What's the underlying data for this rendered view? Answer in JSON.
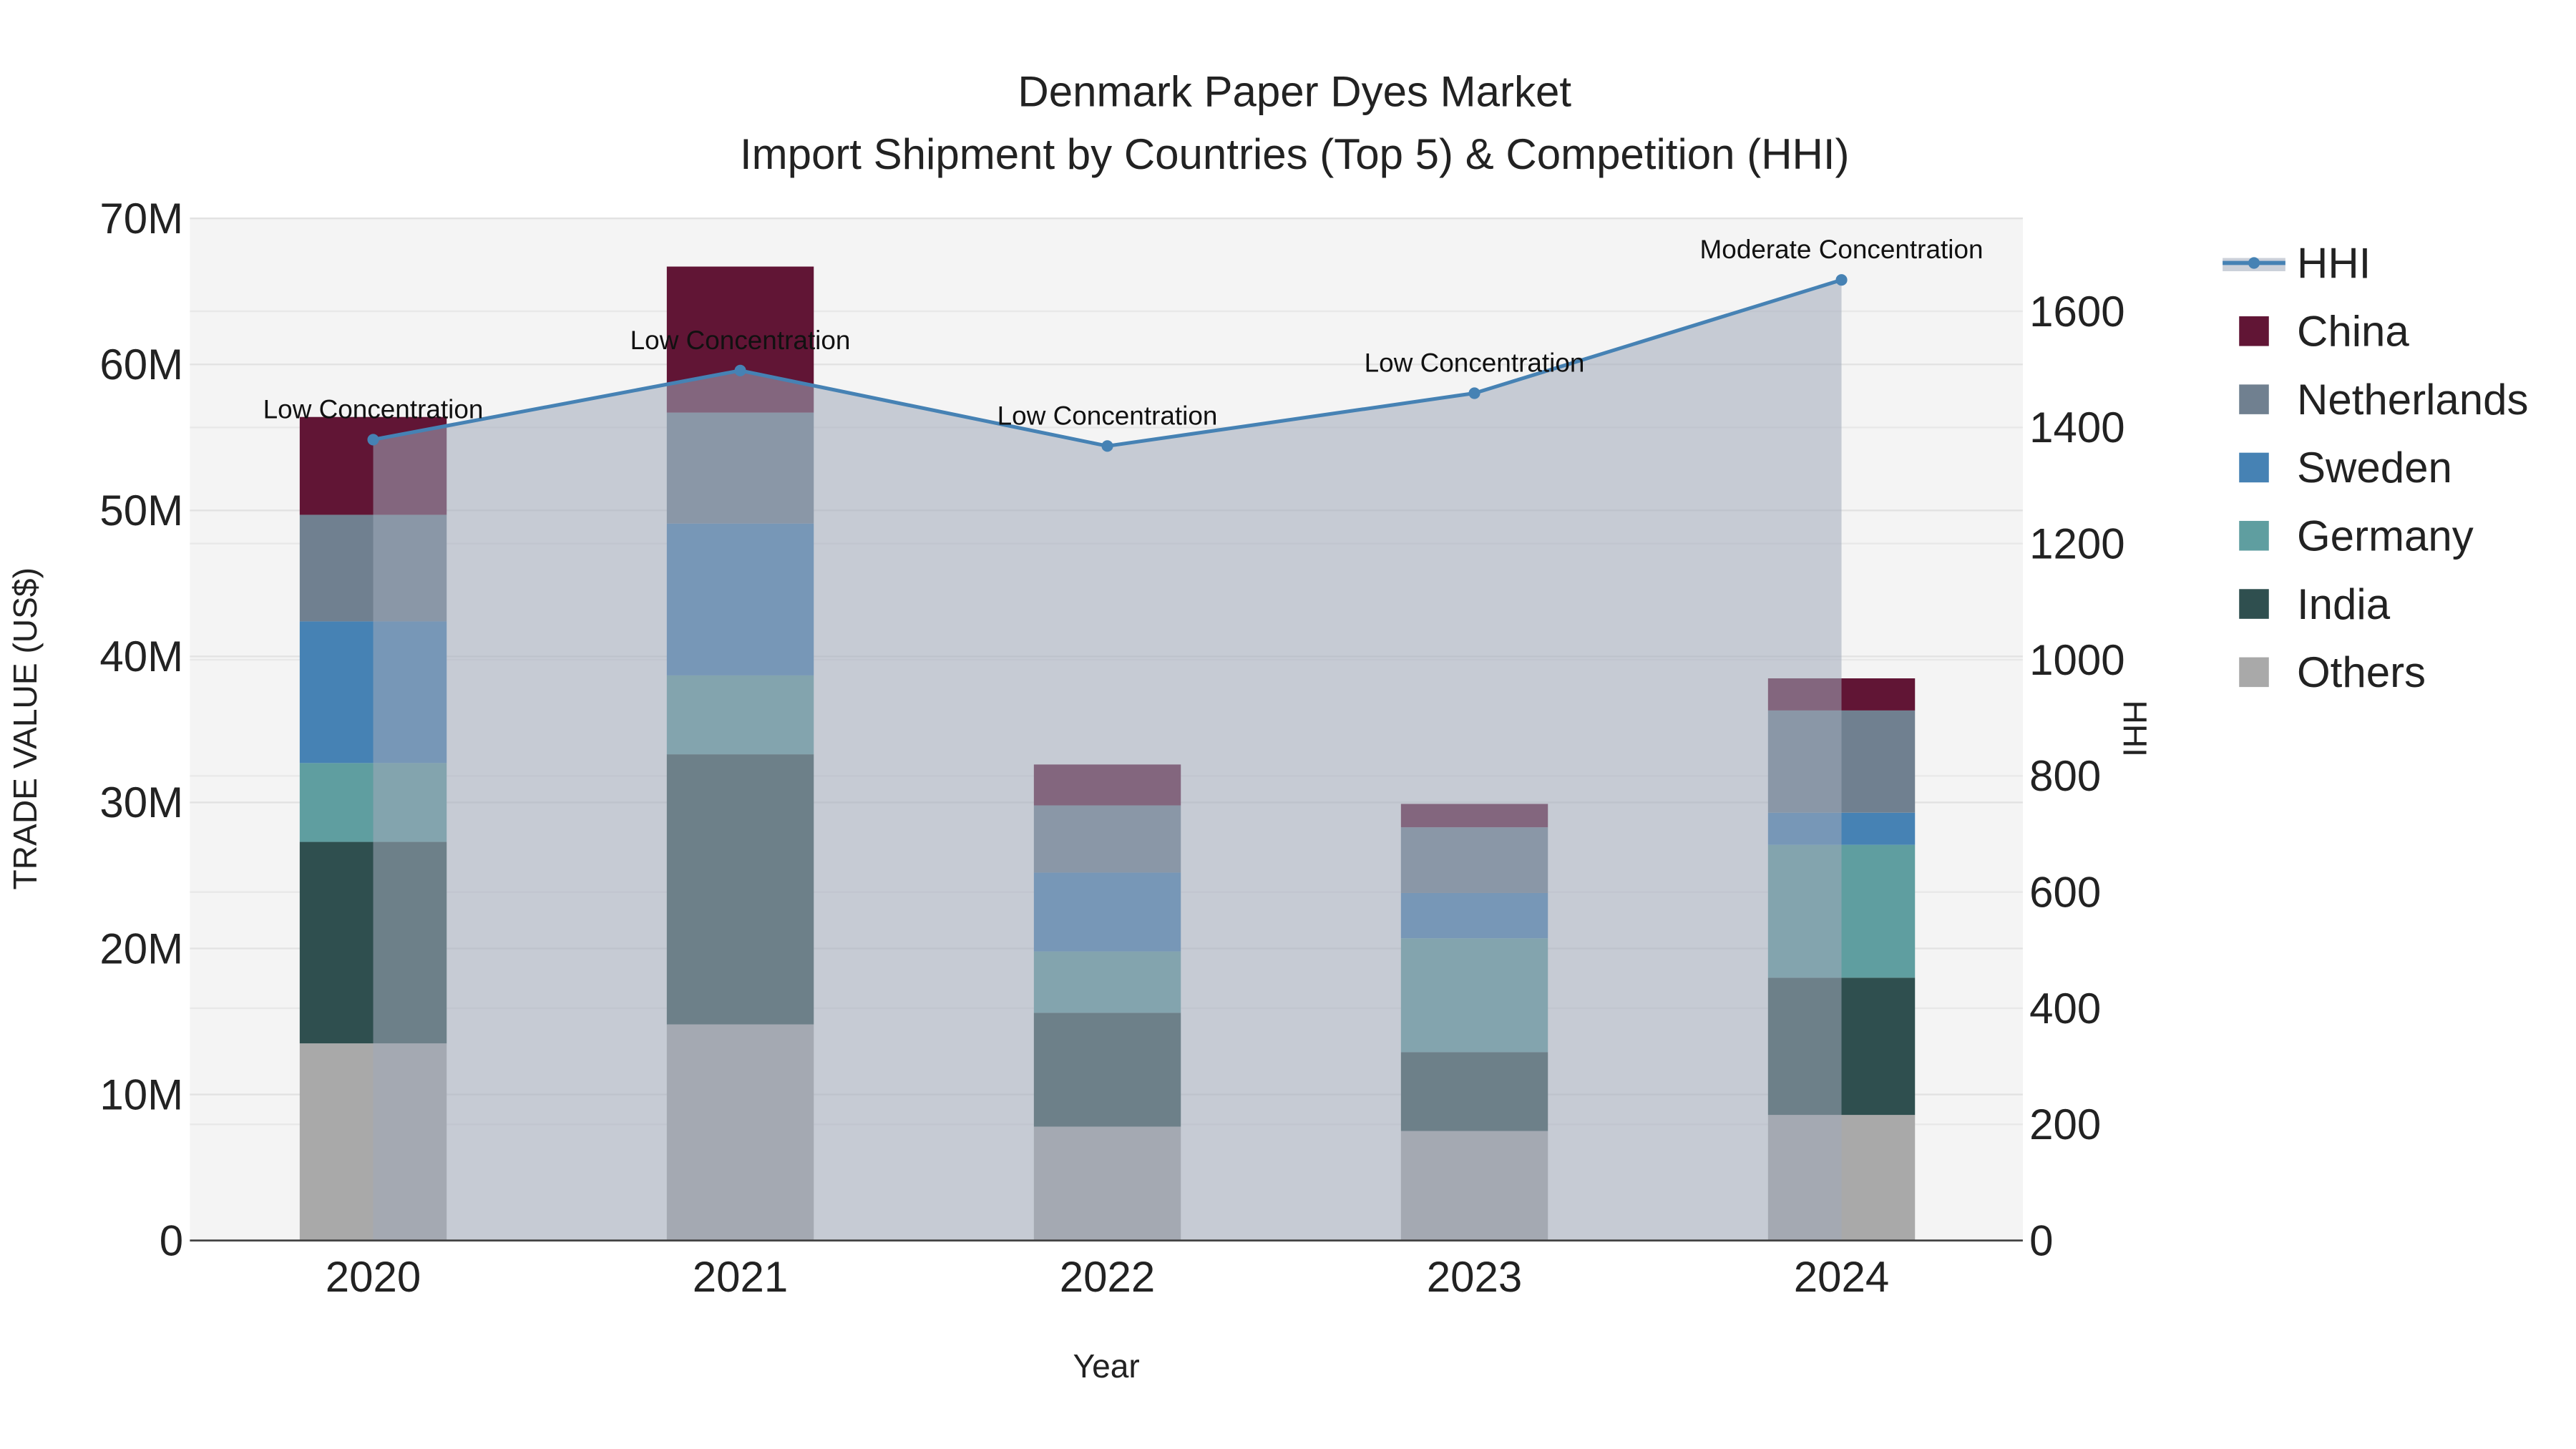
{
  "chart_data": {
    "type": "bar",
    "stacked": true,
    "title": "Denmark Paper Dyes Market",
    "subtitle": "Import Shipment by Countries (Top 5) & Competition (HHI)",
    "xlabel": "Year",
    "ylabel": "TRADE VALUE (US$)",
    "y2label": "HHI",
    "categories": [
      "2020",
      "2021",
      "2022",
      "2023",
      "2024"
    ],
    "ylim": [
      0,
      70000000
    ],
    "y_ticks": [
      0,
      10000000,
      20000000,
      30000000,
      40000000,
      50000000,
      60000000,
      70000000
    ],
    "y_tick_labels": [
      "0",
      "10M",
      "20M",
      "30M",
      "40M",
      "50M",
      "60M",
      "70M"
    ],
    "y2lim": [
      0,
      1760
    ],
    "y2_ticks": [
      0,
      200,
      400,
      600,
      800,
      1000,
      1200,
      1400,
      1600
    ],
    "y2_tick_labels": [
      "0",
      "200",
      "400",
      "600",
      "800",
      "1000",
      "1200",
      "1400",
      "1600"
    ],
    "series": [
      {
        "name": "Others",
        "color": "#a9a9a9",
        "values": [
          13500000,
          14800000,
          7800000,
          7500000,
          8600000
        ]
      },
      {
        "name": "India",
        "color": "#2f4f4f",
        "values": [
          13800000,
          18500000,
          7800000,
          5400000,
          9400000
        ]
      },
      {
        "name": "Germany",
        "color": "#5f9ea0",
        "values": [
          5400000,
          5400000,
          4200000,
          7800000,
          9100000
        ]
      },
      {
        "name": "Sweden",
        "color": "#4682b4",
        "values": [
          9700000,
          10400000,
          5400000,
          3100000,
          2200000
        ]
      },
      {
        "name": "Netherlands",
        "color": "#708090",
        "values": [
          7300000,
          7600000,
          4600000,
          4500000,
          7000000
        ]
      },
      {
        "name": "China",
        "color": "#611535",
        "values": [
          6700000,
          10000000,
          2800000,
          1600000,
          2200000
        ]
      }
    ],
    "hhi": {
      "name": "HHI",
      "color": "#4682b4",
      "values": [
        1379,
        1498,
        1368,
        1459,
        1654
      ],
      "annotations": [
        "Low Concentration",
        "Low Concentration",
        "Low Concentration",
        "Low Concentration",
        "Moderate Concentration"
      ]
    },
    "legend": {
      "placement": "right",
      "entries": [
        "HHI",
        "China",
        "Netherlands",
        "Sweden",
        "Germany",
        "India",
        "Others"
      ]
    },
    "grid": true
  }
}
